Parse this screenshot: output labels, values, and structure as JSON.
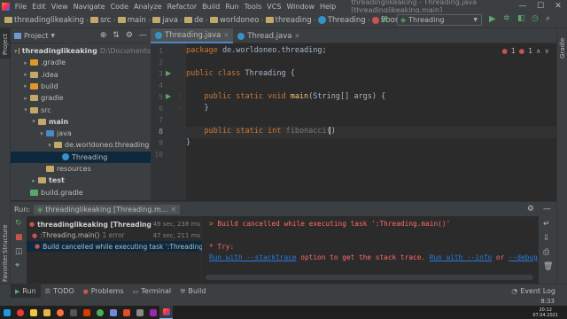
{
  "menubar": {
    "items": [
      "File",
      "Edit",
      "View",
      "Navigate",
      "Code",
      "Analyze",
      "Refactor",
      "Build",
      "Run",
      "Tools",
      "VCS",
      "Window",
      "Help"
    ],
    "title": "threadinglikeaking - Threading.java [threadinglikeaking.main]"
  },
  "navbar": {
    "crumbs": [
      "threadinglikeaking",
      "src",
      "main",
      "java",
      "de",
      "worldoneo",
      "threading",
      "Threading",
      "fibonacci"
    ],
    "run_config": "Threading"
  },
  "left_strip": {
    "project": "Project",
    "structure": "Structure",
    "favorites": "Favorites"
  },
  "right_strip": {
    "gradle": "Gradle"
  },
  "project": {
    "title": "Project",
    "tree": [
      {
        "label": "threadinglikeaking",
        "extra": "D:\\Documents",
        "depth": 0,
        "arrow": "▾",
        "icon": "folder",
        "bold": true
      },
      {
        "label": ".gradle",
        "depth": 1,
        "arrow": "▸",
        "icon": "folder-orange"
      },
      {
        "label": ".idea",
        "depth": 1,
        "arrow": "▸",
        "icon": "folder"
      },
      {
        "label": "build",
        "depth": 1,
        "arrow": "▸",
        "icon": "folder-orange"
      },
      {
        "label": "gradle",
        "depth": 1,
        "arrow": "▸",
        "icon": "folder"
      },
      {
        "label": "src",
        "depth": 1,
        "arrow": "▾",
        "icon": "folder"
      },
      {
        "label": "main",
        "depth": 2,
        "arrow": "▾",
        "icon": "folder",
        "bold": true
      },
      {
        "label": "java",
        "depth": 3,
        "arrow": "▾",
        "icon": "folder-blue"
      },
      {
        "label": "de.worldoneo.threading",
        "depth": 4,
        "arrow": "▾",
        "icon": "package"
      },
      {
        "label": "Threading",
        "depth": 5,
        "arrow": "",
        "icon": "class",
        "selected": true
      },
      {
        "label": "resources",
        "depth": 3,
        "arrow": "",
        "icon": "folder"
      },
      {
        "label": "test",
        "depth": 2,
        "arrow": "▸",
        "icon": "folder",
        "bold": true
      },
      {
        "label": "build.gradle",
        "depth": 1,
        "arrow": "",
        "icon": "gradle"
      }
    ]
  },
  "editor": {
    "tabs": [
      {
        "label": "Threading.java",
        "active": true
      },
      {
        "label": "Thread.java",
        "active": false
      }
    ],
    "inspection": {
      "errors": "1",
      "warnings": "1"
    },
    "line_numbers": [
      "1",
      "2",
      "3",
      "4",
      "5",
      "6",
      "7",
      "8",
      "9",
      "10"
    ],
    "lines": [
      [
        {
          "t": "package ",
          "c": "kw"
        },
        {
          "t": "de.worldoneo.threading;",
          "c": ""
        }
      ],
      [],
      [
        {
          "t": "public class ",
          "c": "kw"
        },
        {
          "t": "Threading {",
          "c": ""
        }
      ],
      [],
      [
        {
          "t": "    public static void ",
          "c": "kw"
        },
        {
          "t": "main",
          "c": "fn"
        },
        {
          "t": "(String[] args) {",
          "c": ""
        }
      ],
      [
        {
          "t": "    }",
          "c": ""
        }
      ],
      [],
      [
        {
          "t": "    public static int ",
          "c": "kw"
        },
        {
          "t": "fibonacci",
          "c": "gr"
        },
        {
          "t": "()",
          "c": ""
        }
      ],
      [
        {
          "t": "}",
          "c": ""
        }
      ],
      []
    ]
  },
  "run_panel": {
    "label": "Run:",
    "tab": "threadinglikeaking [Threading.m...",
    "tree": [
      {
        "label": "threadinglikeaking [Threading.main()",
        "time": "49 sec, 238 ms",
        "status": "error",
        "bold": true,
        "depth": 0
      },
      {
        "label": ":Threading.main()",
        "extra": "1 error",
        "time": "47 sec, 211 ms",
        "status": "error",
        "depth": 1
      },
      {
        "label": "Build cancelled while executing task ':Threading.main()'",
        "status": "error",
        "depth": 2,
        "selected": true
      }
    ],
    "console": {
      "line1": "> Build cancelled while executing task ':Threading.main()'",
      "line2": "* Try:",
      "line3_link1": "Run with --stacktrace",
      "line3_mid": " option to get the stack trace. ",
      "line3_link2": "Run with --info",
      "line3_or": " or ",
      "line3_link3": "--debug"
    }
  },
  "bottom_tabs": [
    "Run",
    "TODO",
    "Problems",
    "Terminal",
    "Build"
  ],
  "event_log": "Event Log",
  "status": {
    "position": "8:33"
  },
  "taskbar": {
    "time": "20:12",
    "date": "07.04.2021"
  },
  "colors": {
    "accent": "#4a88c7",
    "error": "#c75450",
    "keyword": "#cc7832",
    "method": "#ffc66d",
    "link": "#287bde"
  }
}
